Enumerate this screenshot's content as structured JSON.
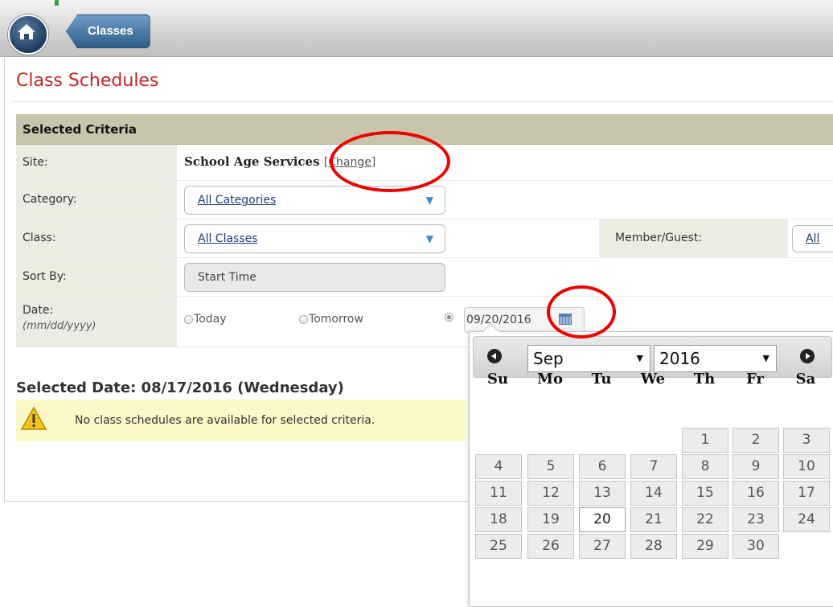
{
  "header": {
    "breadcrumb_label": "Classes"
  },
  "page": {
    "title": "Class Schedules"
  },
  "criteria": {
    "heading": "Selected Criteria",
    "site": {
      "label": "Site:",
      "value": "School Age Services",
      "change_link": "[Change]"
    },
    "category": {
      "label": "Category:",
      "selected": "All Categories"
    },
    "class": {
      "label": "Class:",
      "selected": "All Classes"
    },
    "member_guest": {
      "label": "Member/Guest:",
      "selected": "All"
    },
    "sort_by": {
      "label": "Sort By:",
      "value": "Start Time"
    },
    "date": {
      "label": "Date:",
      "format_hint": "(mm/dd/yyyy)",
      "options": [
        "Today",
        "Tomorrow"
      ],
      "selected_option": "custom",
      "value": "09/20/2016"
    }
  },
  "results": {
    "selected_date": "Selected Date: 08/17/2016 (Wednesday)",
    "notice": "No class schedules are available for selected criteria."
  },
  "datepicker": {
    "month": "Sep",
    "year": "2016",
    "weekdays": [
      "Su",
      "Mo",
      "Tu",
      "We",
      "Th",
      "Fr",
      "Sa"
    ],
    "first_weekday_index": 4,
    "days_in_month": 30,
    "highlighted_day": 20
  },
  "colors": {
    "title_red": "#c8231f",
    "criteria_header": "#c7c6ac",
    "notice_bg": "#fcf8c8",
    "annotation_circle": "#e00000"
  },
  "icons": {
    "home": "home-icon",
    "calendar": "calendar-icon",
    "warning": "warning-icon"
  }
}
